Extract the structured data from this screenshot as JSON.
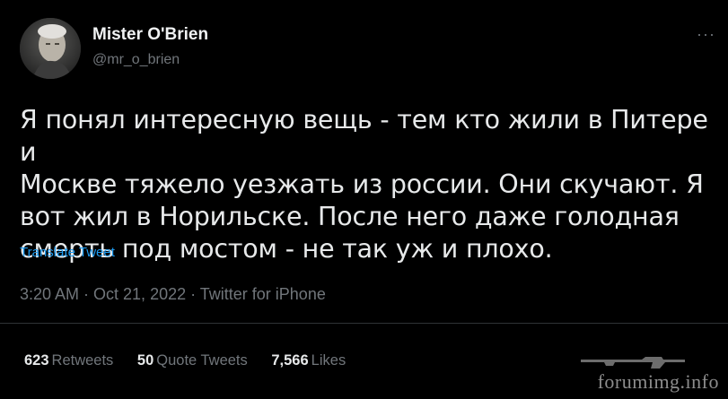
{
  "author": {
    "name": "Mister O'Brien",
    "handle": "@mr_o_brien"
  },
  "tweet": {
    "text": "Я понял интересную вещь - тем кто жили в Питере и\nМоскве тяжело уезжать из россии. Они скучают. Я\nвот жил в Норильске. После него даже голодная\nсмерть под мостом - не так уж и плохо.",
    "translate_label": "Translate Tweet",
    "meta": "3:20 AM · Oct 21, 2022 · Twitter for iPhone"
  },
  "stats": {
    "retweets_count": "623",
    "retweets_label": "Retweets",
    "quote_count": "50",
    "quote_label": "Quote Tweets",
    "likes_count": "7,566",
    "likes_label": "Likes"
  },
  "menu_icon": "more-icon",
  "watermark": "forumimg.info"
}
